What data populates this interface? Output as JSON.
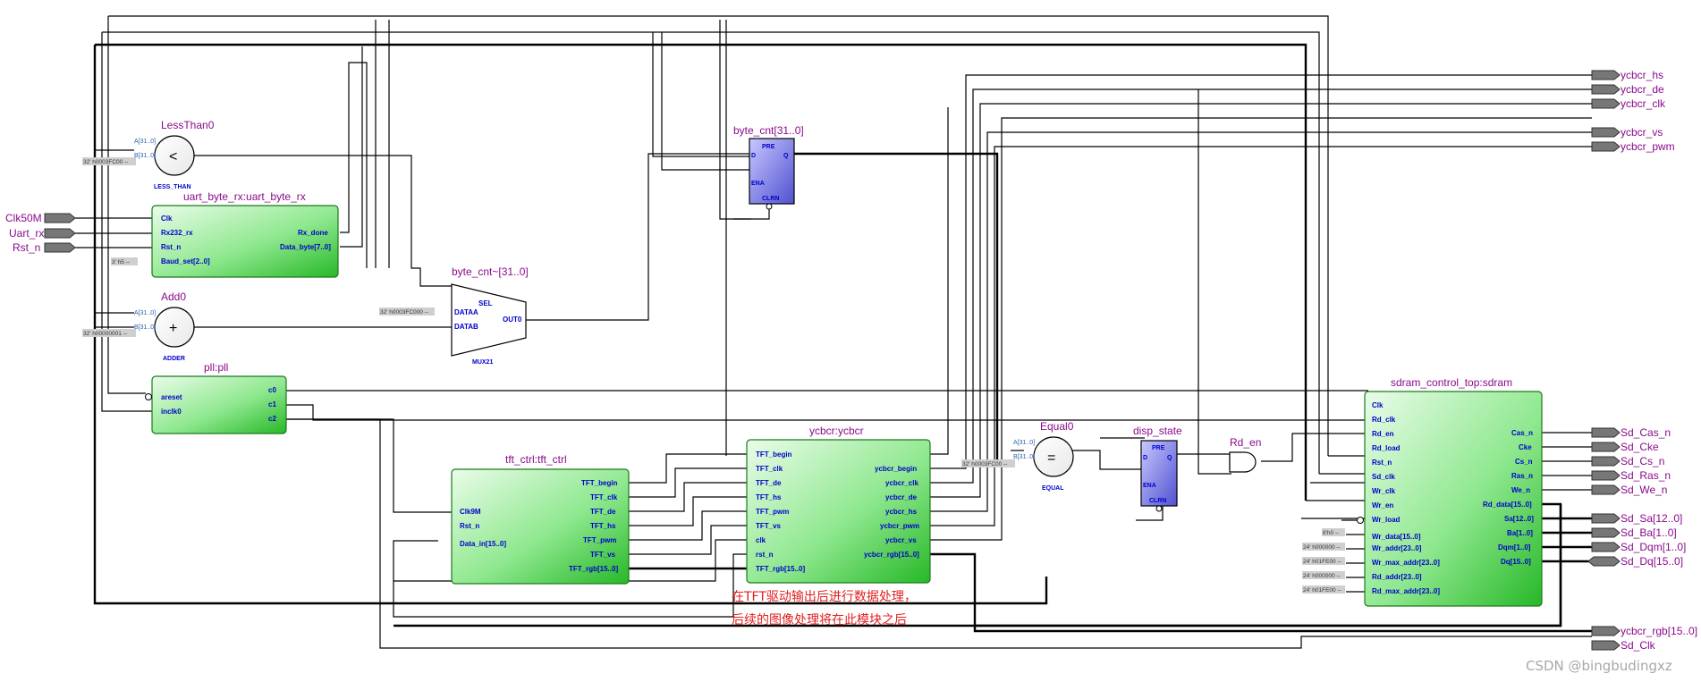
{
  "input_pins": [
    "Clk50M",
    "Uart_rx",
    "Rst_n"
  ],
  "output_pins_top": [
    "ycbcr_hs",
    "ycbcr_de",
    "ycbcr_clk",
    "ycbcr_vs",
    "ycbcr_pwm"
  ],
  "output_pins_right": [
    "Sd_Cas_n",
    "Sd_Cke",
    "Sd_Cs_n",
    "Sd_Ras_n",
    "Sd_We_n",
    "Sd_Sa[12..0]",
    "Sd_Ba[1..0]",
    "Sd_Dqm[1..0]",
    "Sd_Dq[15..0]"
  ],
  "output_pins_bottom": [
    "ycbcr_rgb[15..0]",
    "Sd_Clk"
  ],
  "less_than": {
    "title": "LessThan0",
    "sym": "<",
    "sub": "LESS_THAN",
    "a": "A[31..0]",
    "b": "B[31..0]",
    "const": "32' h0003FC00 --"
  },
  "adder": {
    "title": "Add0",
    "sym": "+",
    "sub": "ADDER",
    "a": "A[31..0]",
    "b": "B[31..0]",
    "const": "32' h00000001 --"
  },
  "equal": {
    "title": "Equal0",
    "sym": "=",
    "sub": "EQUAL",
    "a": "A[31..0]",
    "b": "B[31..0]",
    "const": "32' h0003FC00 --"
  },
  "uart": {
    "title": "uart_byte_rx:uart_byte_rx",
    "in": [
      "Clk",
      "Rx232_rx",
      "Rst_n",
      "Baud_set[2..0]"
    ],
    "out": [
      "Rx_done",
      "Data_byte[7..0]"
    ],
    "const": "3' h5 --"
  },
  "pll": {
    "title": "pll:pll",
    "in": [
      "areset",
      "inclk0"
    ],
    "out": [
      "c0",
      "c1",
      "c2"
    ]
  },
  "mux": {
    "title": "byte_cnt~[31..0]",
    "sel": "SEL",
    "a": "DATAA",
    "b": "DATAB",
    "out": "OUT0",
    "sub": "MUX21",
    "const": "32' h0003FC000 --"
  },
  "byte_cnt": {
    "title": "byte_cnt[31..0]",
    "pre": "PRE",
    "d": "D",
    "q": "Q",
    "ena": "ENA",
    "clrn": "CLRN"
  },
  "disp_state": {
    "title": "disp_state",
    "pre": "PRE",
    "d": "D",
    "q": "Q",
    "ena": "ENA",
    "clrn": "CLRN"
  },
  "rd_en": {
    "title": "Rd_en"
  },
  "tft": {
    "title": "tft_ctrl:tft_ctrl",
    "in": [
      "Clk9M",
      "Rst_n",
      "Data_in[15..0]"
    ],
    "out": [
      "TFT_begin",
      "TFT_clk",
      "TFT_de",
      "TFT_hs",
      "TFT_pwm",
      "TFT_vs",
      "TFT_rgb[15..0]"
    ]
  },
  "ycbcr": {
    "title": "ycbcr:ycbcr",
    "in": [
      "TFT_begin",
      "TFT_clk",
      "TFT_de",
      "TFT_hs",
      "TFT_pwm",
      "TFT_vs",
      "clk",
      "rst_n",
      "TFT_rgb[15..0]"
    ],
    "out": [
      "ycbcr_begin",
      "ycbcr_clk",
      "ycbcr_de",
      "ycbcr_hs",
      "ycbcr_pwm",
      "ycbcr_vs",
      "ycbcr_rgb[15..0]"
    ]
  },
  "sdram": {
    "title": "sdram_control_top:sdram",
    "in": [
      "Clk",
      "Rd_clk",
      "Rd_en",
      "Rd_load",
      "Rst_n",
      "Sd_clk",
      "Wr_clk",
      "Wr_en",
      "Wr_load",
      "Wr_data[15..0]",
      "Wr_addr[23..0]",
      "Wr_max_addr[23..0]",
      "Rd_addr[23..0]",
      "Rd_max_addr[23..0]"
    ],
    "out": [
      "Cas_n",
      "Cke",
      "Cs_n",
      "Ras_n",
      "We_n",
      "Rd_data[15..0]",
      "Sa[12..0]",
      "Ba[1..0]",
      "Dqm[1..0]",
      "Dq[15..0]"
    ],
    "consts": [
      "8'h0 --",
      "24' h000000 --",
      "24' h01FE00 --",
      "24' h000000 --",
      "24' h01FE00 --"
    ]
  },
  "note": [
    "在TFT驱动输出后进行数据处理，",
    "后续的图像处理将在此模块之后"
  ],
  "watermark": "CSDN @bingbudingxz",
  "colors": {
    "module_green_light": "#e6fae6",
    "module_green_dark": "#2ab82a",
    "ff_blue": "#6f6fe0",
    "title_purple": "#8b0a8b",
    "port_blue": "#0000cc",
    "note_red": "#e02020"
  }
}
